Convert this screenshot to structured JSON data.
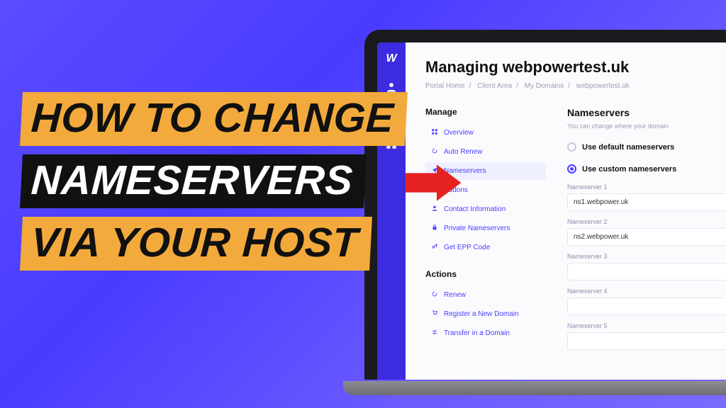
{
  "overlay": {
    "line1": "HOW TO CHANGE",
    "line2": "NAMESERVERS",
    "line3": "VIA YOUR HOST"
  },
  "colors": {
    "accent": "#4a3cff",
    "highlight": "#f3aa3c",
    "arrow": "#e11"
  },
  "rail": {
    "logo": "W"
  },
  "page": {
    "title": "Managing webpowertest.uk",
    "breadcrumb": [
      "Portal Home",
      "Client Area",
      "My Domains",
      "webpowertest.uk"
    ]
  },
  "sidebar": {
    "manage_heading": "Manage",
    "manage": [
      {
        "icon": "grid",
        "label": "Overview"
      },
      {
        "icon": "refresh",
        "label": "Auto Renew"
      },
      {
        "icon": "share",
        "label": "Nameservers",
        "active": true
      },
      {
        "icon": "plus",
        "label": "Addons"
      },
      {
        "icon": "user",
        "label": "Contact Information"
      },
      {
        "icon": "lock",
        "label": "Private Nameservers"
      },
      {
        "icon": "key",
        "label": "Get EPP Code"
      }
    ],
    "actions_heading": "Actions",
    "actions": [
      {
        "icon": "refresh",
        "label": "Renew"
      },
      {
        "icon": "cart",
        "label": "Register a New Domain"
      },
      {
        "icon": "transfer",
        "label": "Transfer in a Domain"
      }
    ]
  },
  "panel": {
    "heading": "Nameservers",
    "sub": "You can change where your domain",
    "radio_default": "Use default nameservers",
    "radio_custom": "Use custom nameservers",
    "fields": [
      {
        "label": "Nameserver 1",
        "value": "ns1.webpower.uk"
      },
      {
        "label": "Nameserver 2",
        "value": "ns2.webpower.uk"
      },
      {
        "label": "Nameserver 3",
        "value": ""
      },
      {
        "label": "Nameserver 4",
        "value": ""
      },
      {
        "label": "Nameserver 5",
        "value": ""
      }
    ]
  }
}
